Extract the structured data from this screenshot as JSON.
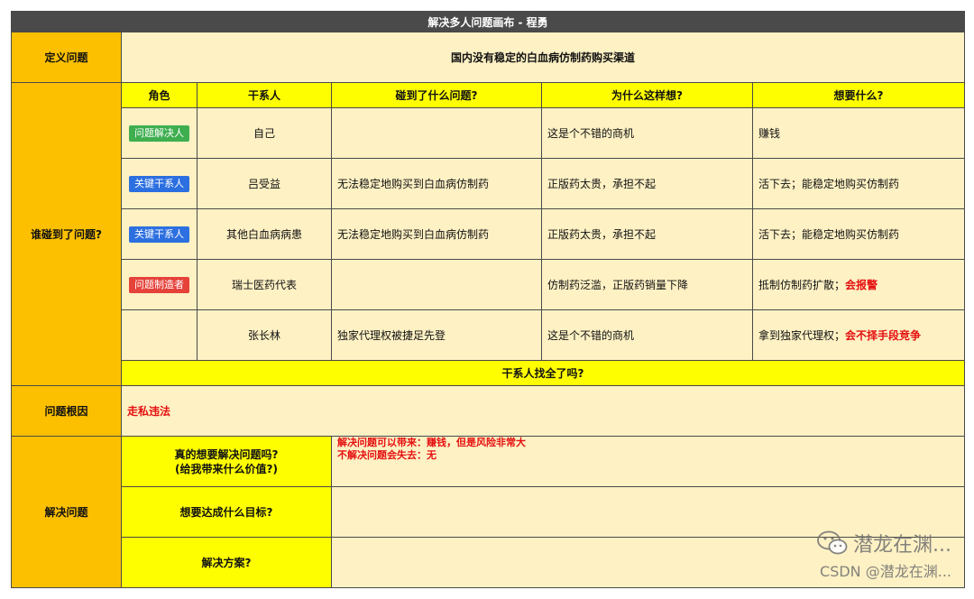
{
  "title": "解决多人问题画布 - 程勇",
  "define": {
    "label": "定义问题",
    "content": "国内没有稳定的白血病仿制药购买渠道"
  },
  "who": {
    "label": "谁碰到了问题?",
    "headers": {
      "role": "角色",
      "stakeholder": "干系人",
      "problem": "碰到了什么问题?",
      "why": "为什么这样想?",
      "want": "想要什么?"
    },
    "rows": [
      {
        "role": "问题解决人",
        "role_color": "#3eae4f",
        "stakeholder": "自己",
        "problem": "",
        "why": "这是个不错的商机",
        "want": "赚钱",
        "want_red": ""
      },
      {
        "role": "关键干系人",
        "role_color": "#2c6fe0",
        "stakeholder": "吕受益",
        "problem": "无法稳定地购买到白血病仿制药",
        "why": "正版药太贵，承担不起",
        "want": "活下去；能稳定地购买仿制药",
        "want_red": ""
      },
      {
        "role": "关键干系人",
        "role_color": "#2c6fe0",
        "stakeholder": "其他白血病病患",
        "problem": "无法稳定地购买到白血病仿制药",
        "why": "正版药太贵，承担不起",
        "want": "活下去；能稳定地购买仿制药",
        "want_red": ""
      },
      {
        "role": "问题制造者",
        "role_color": "#e5423a",
        "stakeholder": "瑞士医药代表",
        "problem": "",
        "why": "仿制药泛滥，正版药销量下降",
        "want": "抵制仿制药扩散；",
        "want_red": "会报警"
      },
      {
        "role": "",
        "role_color": "",
        "stakeholder": "张长林",
        "problem": "独家代理权被捷足先登",
        "why": "这是个不错的商机",
        "want": "拿到独家代理权；",
        "want_red": "会不择手段竞争"
      }
    ],
    "complete_check": "干系人找全了吗?"
  },
  "root": {
    "label": "问题根因",
    "content": "走私违法"
  },
  "solve": {
    "label": "解决问题",
    "q1_line1": "真的想要解决问题吗?",
    "q1_line2": "(给我带来什么价值?)",
    "a1_line1": "解决问题可以带来：赚钱，但是风险非常大",
    "a1_line2": "不解决问题会失去：无",
    "q2": "想要达成什么目标?",
    "a2": "",
    "q3": "解决方案?",
    "a3": ""
  },
  "watermark": {
    "line1": "潜龙在渊...",
    "line2": "CSDN @潜龙在渊..."
  }
}
